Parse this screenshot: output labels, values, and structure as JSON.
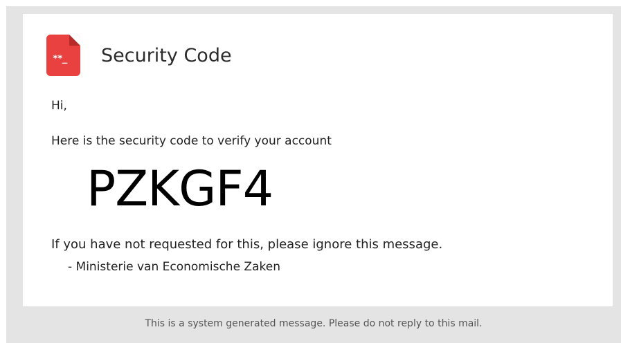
{
  "email": {
    "title": "Security Code",
    "icon": "password-file-icon",
    "icon_glyph": "**_",
    "greeting": "Hi,",
    "intro": "Here is the security code to verify your account",
    "code": "PZKGF4",
    "ignore_notice": "If you have not requested for this, please ignore this message.",
    "signoff": "- Ministerie van Economische Zaken",
    "footer": "This is a system generated message. Please do not reply to this mail."
  },
  "colors": {
    "accent": "#e94040",
    "frame_background": "#e4e4e4",
    "card_background": "#ffffff"
  }
}
